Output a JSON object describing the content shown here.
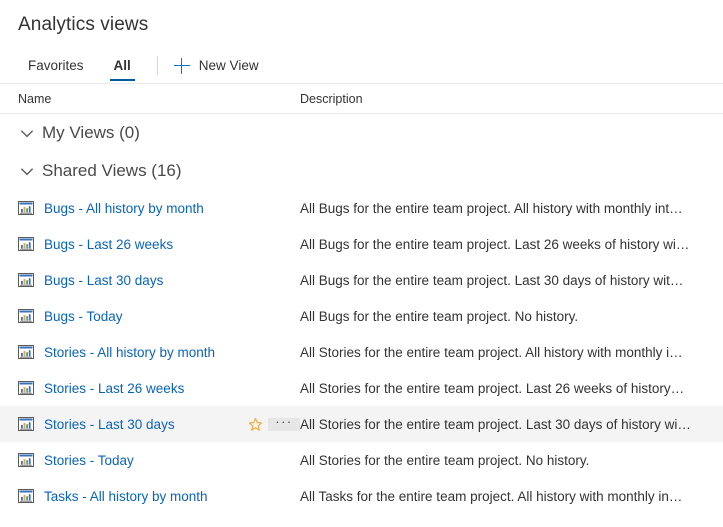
{
  "header": {
    "title": "Analytics views"
  },
  "tabs": [
    {
      "label": "Favorites",
      "selected": false
    },
    {
      "label": "All",
      "selected": true
    }
  ],
  "toolbar": {
    "new_view_label": "New View",
    "new_view_icon": "plus-icon"
  },
  "columns": {
    "name": "Name",
    "description": "Description"
  },
  "colors": {
    "link": "#0a63ba",
    "accent": "#0078d4",
    "tab_underline": "#005a9e",
    "star": "#f2a83b",
    "hover_row": "#f4f4f4",
    "more_button": "#e6e6e6",
    "divider": "#eaeaea",
    "text": "#333333",
    "group_text": "#4a4a4a"
  },
  "groups": [
    {
      "label": "My Views (0)",
      "icon": "chevron-down-icon",
      "expanded": true,
      "rows": []
    },
    {
      "label": "Shared Views (16)",
      "icon": "chevron-down-icon",
      "expanded": true,
      "rows": [
        {
          "icon": "report-chart-icon",
          "name": "Bugs - All history by month",
          "description": "All Bugs for the entire team project. All history with monthly int…",
          "hovered": false
        },
        {
          "icon": "report-chart-icon",
          "name": "Bugs - Last 26 weeks",
          "description": "All Bugs for the entire team project. Last 26 weeks of history wi…",
          "hovered": false
        },
        {
          "icon": "report-chart-icon",
          "name": "Bugs - Last 30 days",
          "description": "All Bugs for the entire team project. Last 30 days of history wit…",
          "hovered": false
        },
        {
          "icon": "report-chart-icon",
          "name": "Bugs - Today",
          "description": "All Bugs for the entire team project. No history.",
          "hovered": false
        },
        {
          "icon": "report-chart-icon",
          "name": "Stories - All history by month",
          "description": "All Stories for the entire team project. All history with monthly i…",
          "hovered": false
        },
        {
          "icon": "report-chart-icon",
          "name": "Stories - Last 26 weeks",
          "description": "All Stories for the entire team project. Last 26 weeks of history…",
          "hovered": false
        },
        {
          "icon": "report-chart-icon",
          "name": "Stories - Last 30 days",
          "description": "All Stories for the entire team project. Last 30 days of history wi…",
          "hovered": true,
          "actions": {
            "favorite_icon": "star-icon",
            "more_icon": "ellipsis-icon",
            "more_label": "···"
          }
        },
        {
          "icon": "report-chart-icon",
          "name": "Stories - Today",
          "description": "All Stories for the entire team project. No history.",
          "hovered": false
        },
        {
          "icon": "report-chart-icon",
          "name": "Tasks - All history by month",
          "description": "All Tasks for the entire team project. All history with monthly in…",
          "hovered": false
        }
      ]
    }
  ]
}
